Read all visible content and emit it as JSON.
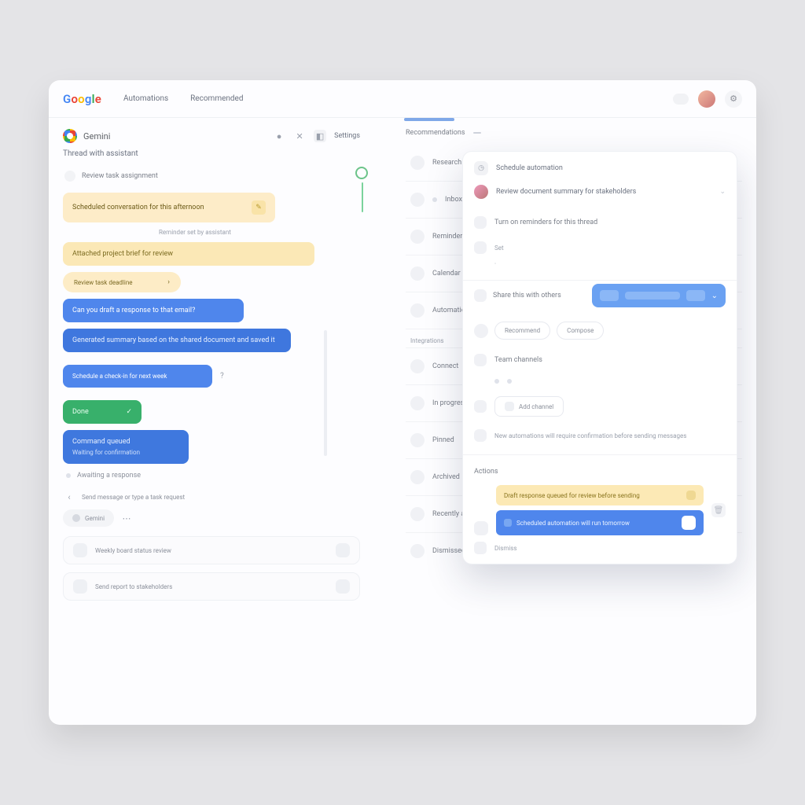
{
  "colors": {
    "blue": "#4f86ec",
    "blue_dark": "#3f77de",
    "green": "#38b06b",
    "yellow": "#fdecc8",
    "divider_accent": "#7fa8e8"
  },
  "topbar": {
    "logo_text": "Google",
    "nav": [
      "Automations",
      "Recommended"
    ],
    "notif_aria": "notifications",
    "avatar_aria": "account",
    "settings_aria": "settings"
  },
  "left": {
    "thread_name": "Gemini",
    "head_icons": [
      "mic",
      "close",
      "mode"
    ],
    "head_right_label": "Settings",
    "section_title": "Thread with assistant",
    "first_line": {
      "text": "Review task assignment",
      "trail": "›"
    },
    "bubbles": [
      {
        "kind": "yellow1",
        "text": "Scheduled conversation for this afternoon"
      },
      {
        "kind": "caption",
        "text": "Reminder set by assistant"
      },
      {
        "kind": "yellow2",
        "text": "Attached project brief for review"
      },
      {
        "kind": "yellowpill",
        "text": "Review task deadline",
        "trail": "›"
      },
      {
        "kind": "blue",
        "text": "Can you draft a response to that email?"
      },
      {
        "kind": "blue-dark",
        "text": "Generated summary based on the shared document and saved it"
      },
      {
        "kind": "blue",
        "text": "Schedule a check-in for next week"
      },
      {
        "kind": "green",
        "text": "Done",
        "trail": "✓"
      },
      {
        "kind": "blue-cmd",
        "line1": "Command queued",
        "line2": "Waiting for confirmation"
      }
    ],
    "after_bubble_icon_aria": "help",
    "reply_line": "Awaiting a response",
    "compose": {
      "prefix_icon_aria": "back",
      "placeholder": "Send message or type a task request",
      "chip_label": "Gemini",
      "chip_trail_aria": "expand"
    },
    "bottom_cards": [
      {
        "text": "Weekly board status review",
        "trail_aria": "open"
      },
      {
        "text": "Send report to stakeholders",
        "trail_aria": "open"
      }
    ]
  },
  "right": {
    "head": {
      "label": "Recommendations",
      "trail_icon_aria": "filter"
    },
    "groups": [
      {
        "section": "",
        "items": [
          "Research assistant"
        ]
      },
      {
        "section": "",
        "items": [
          "Inbox"
        ]
      },
      {
        "section": "",
        "items": [
          "Reminders",
          "Calendar",
          "Automations"
        ]
      },
      {
        "section": "Integrations",
        "items": [
          "Connect"
        ]
      },
      {
        "section": "",
        "items": [
          "In progress",
          "Pinned",
          "Archived",
          "Recently added",
          "Dismissed"
        ]
      }
    ]
  },
  "popup": {
    "title": "Schedule automation",
    "subtitle": "Review document summary for stakeholders",
    "sub_trail_aria": "expand",
    "row1": "Turn on reminders for this thread",
    "row2_label": "Set",
    "section_label": "Share this with others",
    "blue_btn_segments": 3,
    "blue_btn_trail_aria": "options",
    "pills": [
      "Recommend",
      "Compose"
    ],
    "row3_label": "Team channels",
    "mini_row": [
      "",
      ""
    ],
    "row_icon_label": "Add channel",
    "long_note": "New automations will require confirmation before sending messages",
    "footer_label": "Actions",
    "yellow_bar": "Draft response queued for review before sending",
    "blue_bar": "Scheduled automation will run tomorrow",
    "foot_row_label": "Dismiss",
    "trash_aria": "delete"
  }
}
